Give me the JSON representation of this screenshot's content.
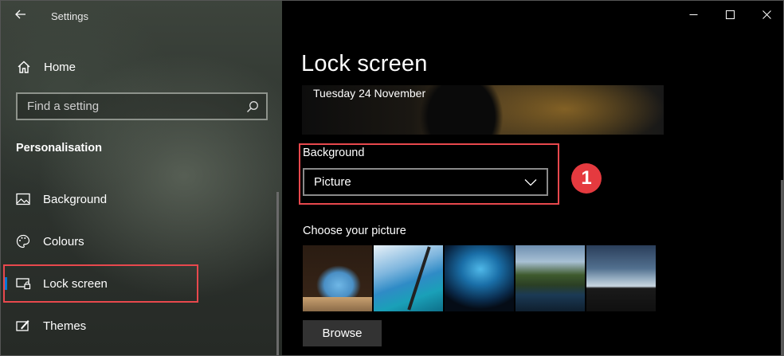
{
  "window": {
    "app_title": "Settings",
    "controls": {
      "minimize_icon": "minimize-icon",
      "maximize_icon": "maximize-icon",
      "close_icon": "close-icon"
    }
  },
  "sidebar": {
    "home_label": "Home",
    "search": {
      "placeholder": "Find a setting",
      "value": ""
    },
    "section_title": "Personalisation",
    "items": [
      {
        "label": "Background",
        "icon": "picture-icon",
        "active": false
      },
      {
        "label": "Colours",
        "icon": "palette-icon",
        "active": false
      },
      {
        "label": "Lock screen",
        "icon": "lock-screen-icon",
        "active": true
      },
      {
        "label": "Themes",
        "icon": "themes-icon",
        "active": false
      }
    ]
  },
  "main": {
    "page_title": "Lock screen",
    "preview_date": "Tuesday 24 November",
    "background_label": "Background",
    "background_value": "Picture",
    "badge": "1",
    "choose_label": "Choose your picture",
    "browse_label": "Browse"
  },
  "colors": {
    "accent": "#0078d7",
    "highlight": "#e8484d",
    "badge": "#e53a3f"
  }
}
